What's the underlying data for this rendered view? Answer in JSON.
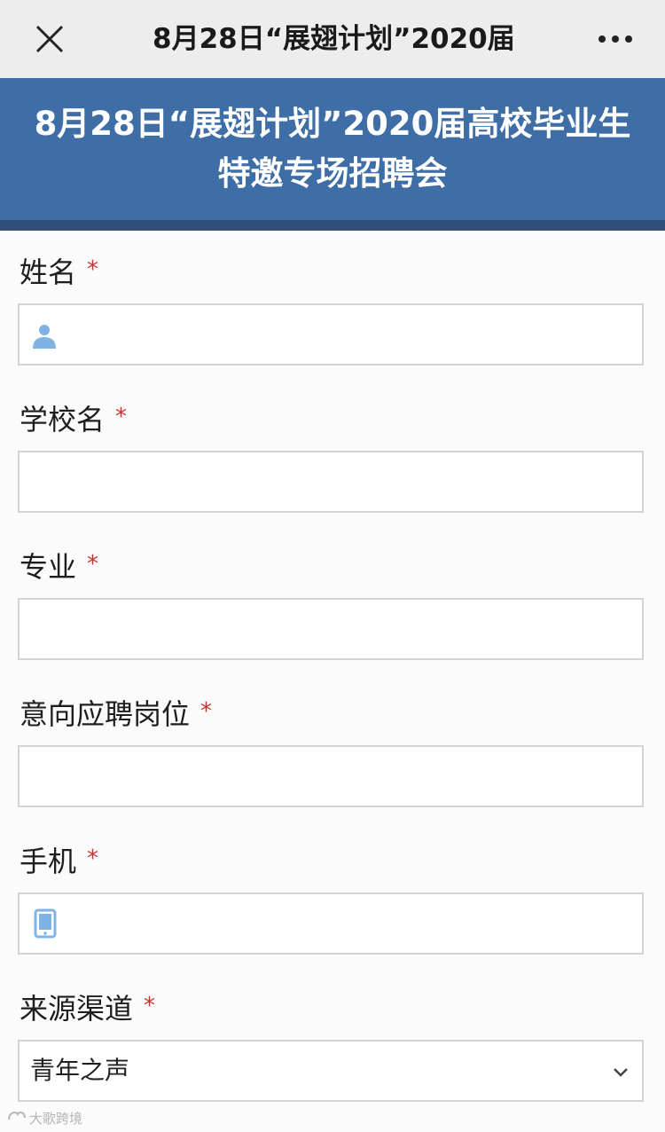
{
  "navbar": {
    "title": "8月28日“展翅计划”2020届",
    "close_icon": "close-icon",
    "more_icon": "more-icon"
  },
  "banner": {
    "line1": "8月28日“展翅计划”2020届高校毕业生",
    "line2": "特邀专场招聘会"
  },
  "form": {
    "required_mark": "*",
    "name": {
      "label": "姓名",
      "icon": "person-icon",
      "value": ""
    },
    "school": {
      "label": "学校名",
      "value": ""
    },
    "major": {
      "label": "专业",
      "value": ""
    },
    "position": {
      "label": "意向应聘岗位",
      "value": ""
    },
    "phone": {
      "label": "手机",
      "icon": "phone-icon",
      "value": ""
    },
    "source": {
      "label": "来源渠道",
      "selected": "青年之声"
    }
  },
  "watermark": {
    "text": "大歌跨境"
  },
  "colors": {
    "banner": "#3f6da6",
    "required": "#c33434",
    "icon": "#7fb3e3"
  }
}
